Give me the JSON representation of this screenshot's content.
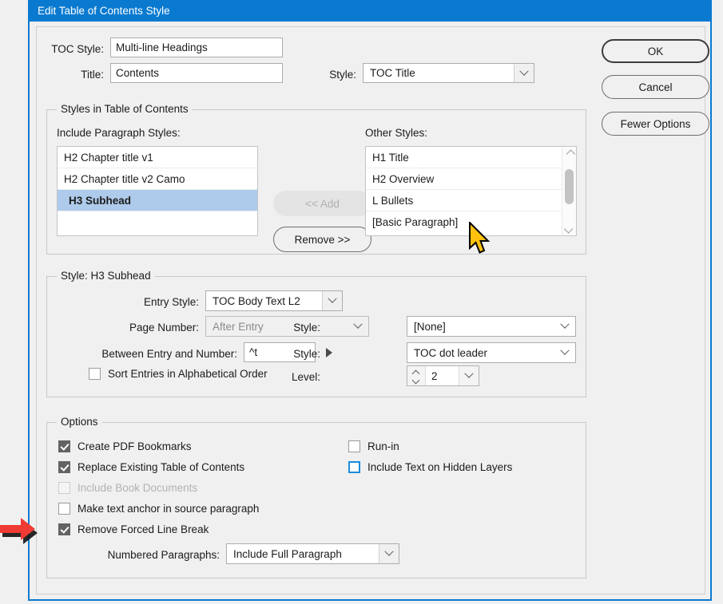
{
  "window": {
    "title": "Edit Table of Contents Style"
  },
  "top_fields": {
    "toc_style_label": "TOC Style:",
    "toc_style_value": "Multi-line Headings",
    "title_label": "Title:",
    "title_value": "Contents",
    "title_style_label": "Style:",
    "title_style_value": "TOC Title"
  },
  "buttons": {
    "ok": "OK",
    "cancel": "Cancel",
    "fewer_options": "Fewer Options"
  },
  "styles_group": {
    "legend": "Styles in Table of Contents",
    "include_label": "Include Paragraph Styles:",
    "other_label": "Other Styles:",
    "add_button": "<< Add",
    "remove_button": "Remove >>",
    "included": [
      {
        "label": "H2 Chapter title v1",
        "selected": false
      },
      {
        "label": "H2 Chapter title v2 Camo",
        "selected": false
      },
      {
        "label": "H3 Subhead",
        "selected": true
      }
    ],
    "other": [
      {
        "label": "H1 Title"
      },
      {
        "label": "H2 Overview"
      },
      {
        "label": "L Bullets"
      },
      {
        "label": "[Basic Paragraph]"
      }
    ]
  },
  "style_group": {
    "legend": "Style: H3 Subhead",
    "entry_style_label": "Entry Style:",
    "entry_style_value": "TOC Body Text L2",
    "page_number_label": "Page Number:",
    "page_number_value": "After Entry",
    "page_number_style_label": "Style:",
    "page_number_style_value": "[None]",
    "between_label": "Between Entry and Number:",
    "between_value": "^t",
    "between_style_label": "Style:",
    "between_style_value": "TOC dot leader",
    "sort_label": "Sort Entries in Alphabetical Order",
    "level_label": "Level:",
    "level_value": "2"
  },
  "options_group": {
    "legend": "Options",
    "left_checks": [
      {
        "label": "Create PDF Bookmarks",
        "checked": true,
        "disabled": false,
        "focus": false
      },
      {
        "label": "Replace Existing Table of Contents",
        "checked": true,
        "disabled": false,
        "focus": false
      },
      {
        "label": "Include Book Documents",
        "checked": false,
        "disabled": true,
        "focus": false
      },
      {
        "label": "Make text anchor in source paragraph",
        "checked": false,
        "disabled": false,
        "focus": false
      },
      {
        "label": "Remove Forced Line Break",
        "checked": true,
        "disabled": false,
        "focus": false
      }
    ],
    "right_checks": [
      {
        "label": "Run-in",
        "checked": false,
        "disabled": false,
        "focus": false
      },
      {
        "label": "Include Text on Hidden Layers",
        "checked": false,
        "disabled": false,
        "focus": true
      }
    ],
    "numbered_label": "Numbered Paragraphs:",
    "numbered_value": "Include Full Paragraph"
  },
  "annotations": {
    "arrow_color": "#ef3b33",
    "cursor_color": "#ffc20e"
  },
  "colors": {
    "titlebar": "#0a7ad0",
    "dialog_bg": "#f0f0f0",
    "selection": "#aecbeb",
    "checkbox_checked": "#636363"
  }
}
